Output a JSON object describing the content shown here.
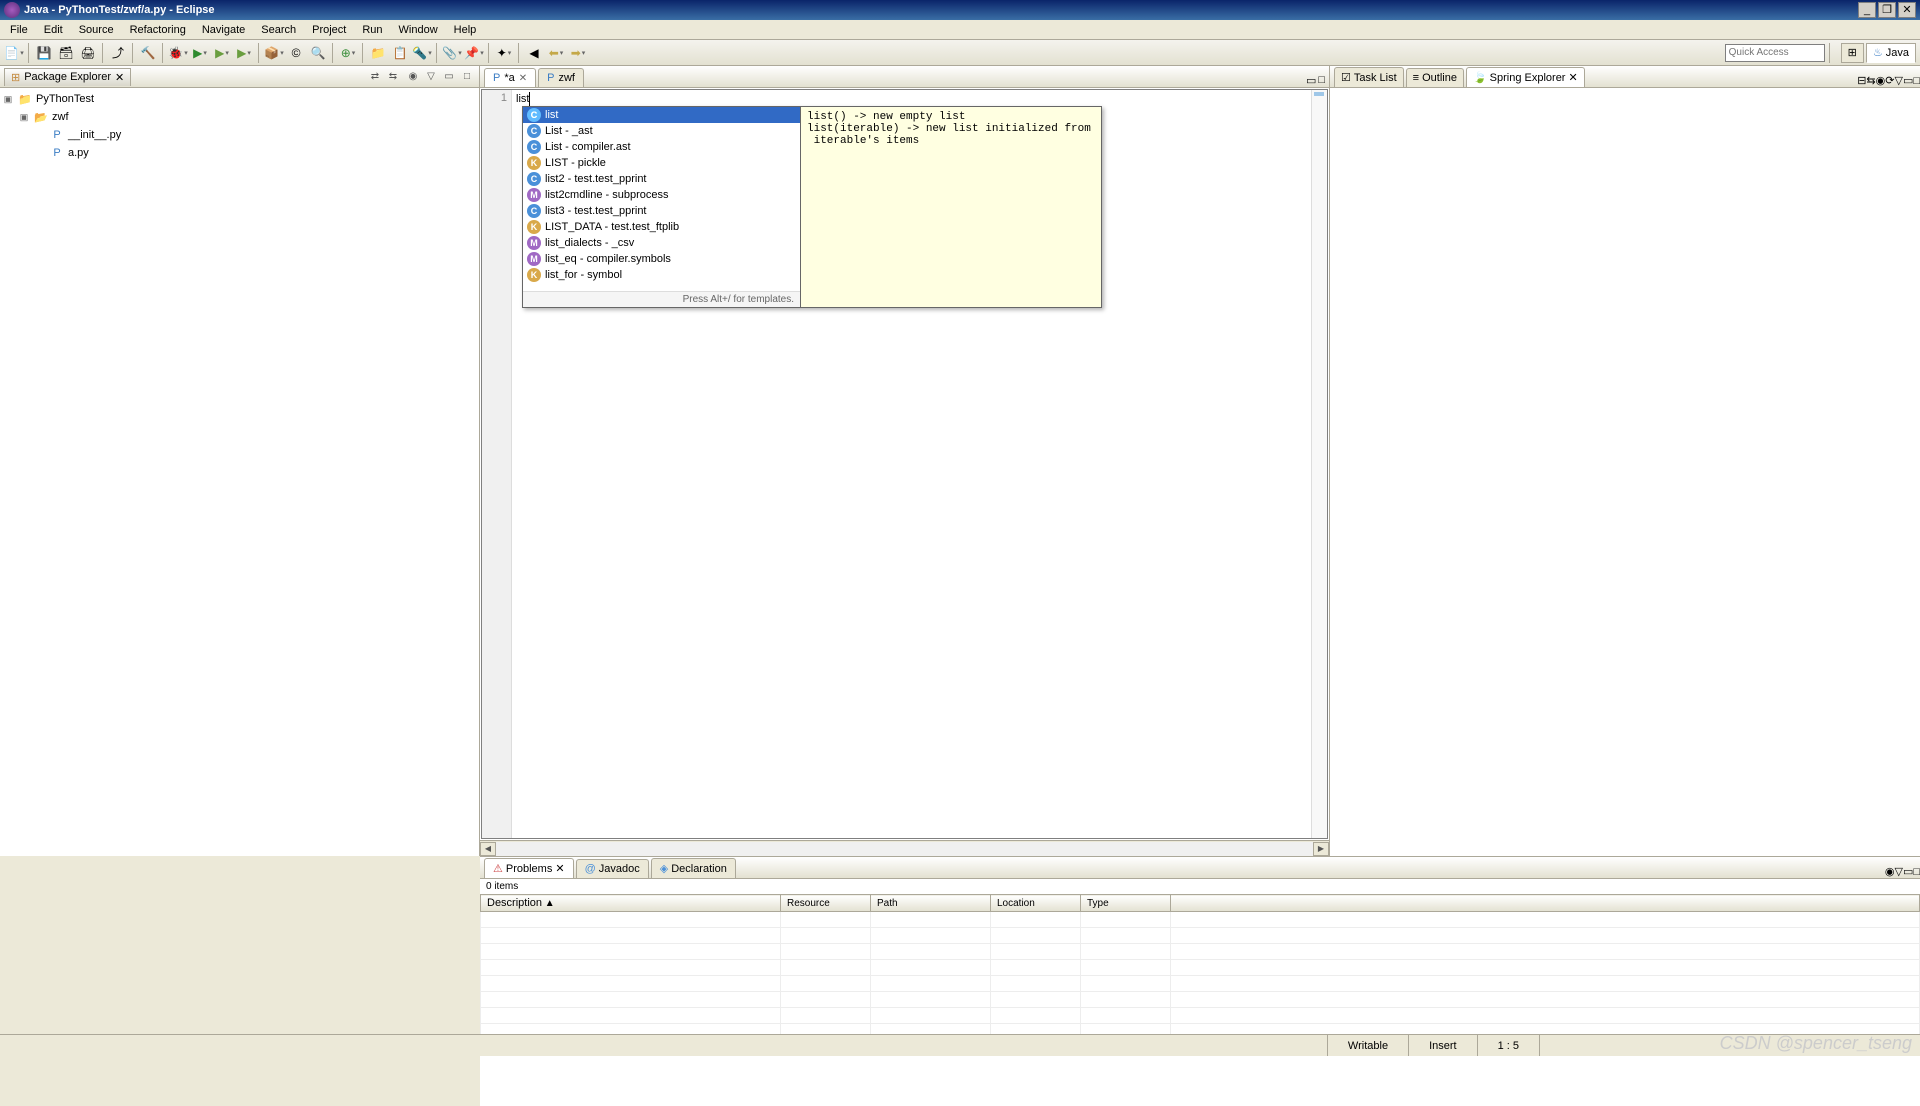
{
  "title": "Java - PyThonTest/zwf/a.py - Eclipse",
  "menus": [
    "File",
    "Edit",
    "Source",
    "Refactoring",
    "Navigate",
    "Search",
    "Project",
    "Run",
    "Window",
    "Help"
  ],
  "quick_access_placeholder": "Quick Access",
  "perspectives": {
    "java": "Java"
  },
  "package_explorer": {
    "title": "Package Explorer",
    "project": "PyThonTest",
    "folder": "zwf",
    "files": [
      "__init__.py",
      "a.py"
    ]
  },
  "editor": {
    "tabs": [
      {
        "label": "*a",
        "active": true
      },
      {
        "label": "zwf",
        "active": false
      }
    ],
    "line_number": "1",
    "code": "list"
  },
  "autocomplete": {
    "items": [
      {
        "icon": "c",
        "label": "list",
        "selected": true
      },
      {
        "icon": "c",
        "label": "List - _ast"
      },
      {
        "icon": "c",
        "label": "List - compiler.ast"
      },
      {
        "icon": "k",
        "label": "LIST - pickle"
      },
      {
        "icon": "c",
        "label": "list2 - test.test_pprint"
      },
      {
        "icon": "m",
        "label": "list2cmdline - subprocess"
      },
      {
        "icon": "c",
        "label": "list3 - test.test_pprint"
      },
      {
        "icon": "k",
        "label": "LIST_DATA - test.test_ftplib"
      },
      {
        "icon": "m",
        "label": "list_dialects - _csv"
      },
      {
        "icon": "m",
        "label": "list_eq - compiler.symbols"
      },
      {
        "icon": "k",
        "label": "list_for - symbol"
      }
    ],
    "hint": "Press Alt+/ for templates.",
    "doc": "list() -> new empty list\nlist(iterable) -> new list initialized from\n iterable's items"
  },
  "right_views": {
    "tabs": [
      "Task List",
      "Outline",
      "Spring Explorer"
    ],
    "active": "Spring Explorer"
  },
  "bottom": {
    "tabs": [
      "Problems",
      "Javadoc",
      "Declaration"
    ],
    "active": "Problems",
    "count": "0 items",
    "columns": [
      "Description",
      "Resource",
      "Path",
      "Location",
      "Type"
    ]
  },
  "status": {
    "writable": "Writable",
    "insert": "Insert",
    "position": "1 : 5"
  },
  "watermark": "CSDN @spencer_tseng"
}
